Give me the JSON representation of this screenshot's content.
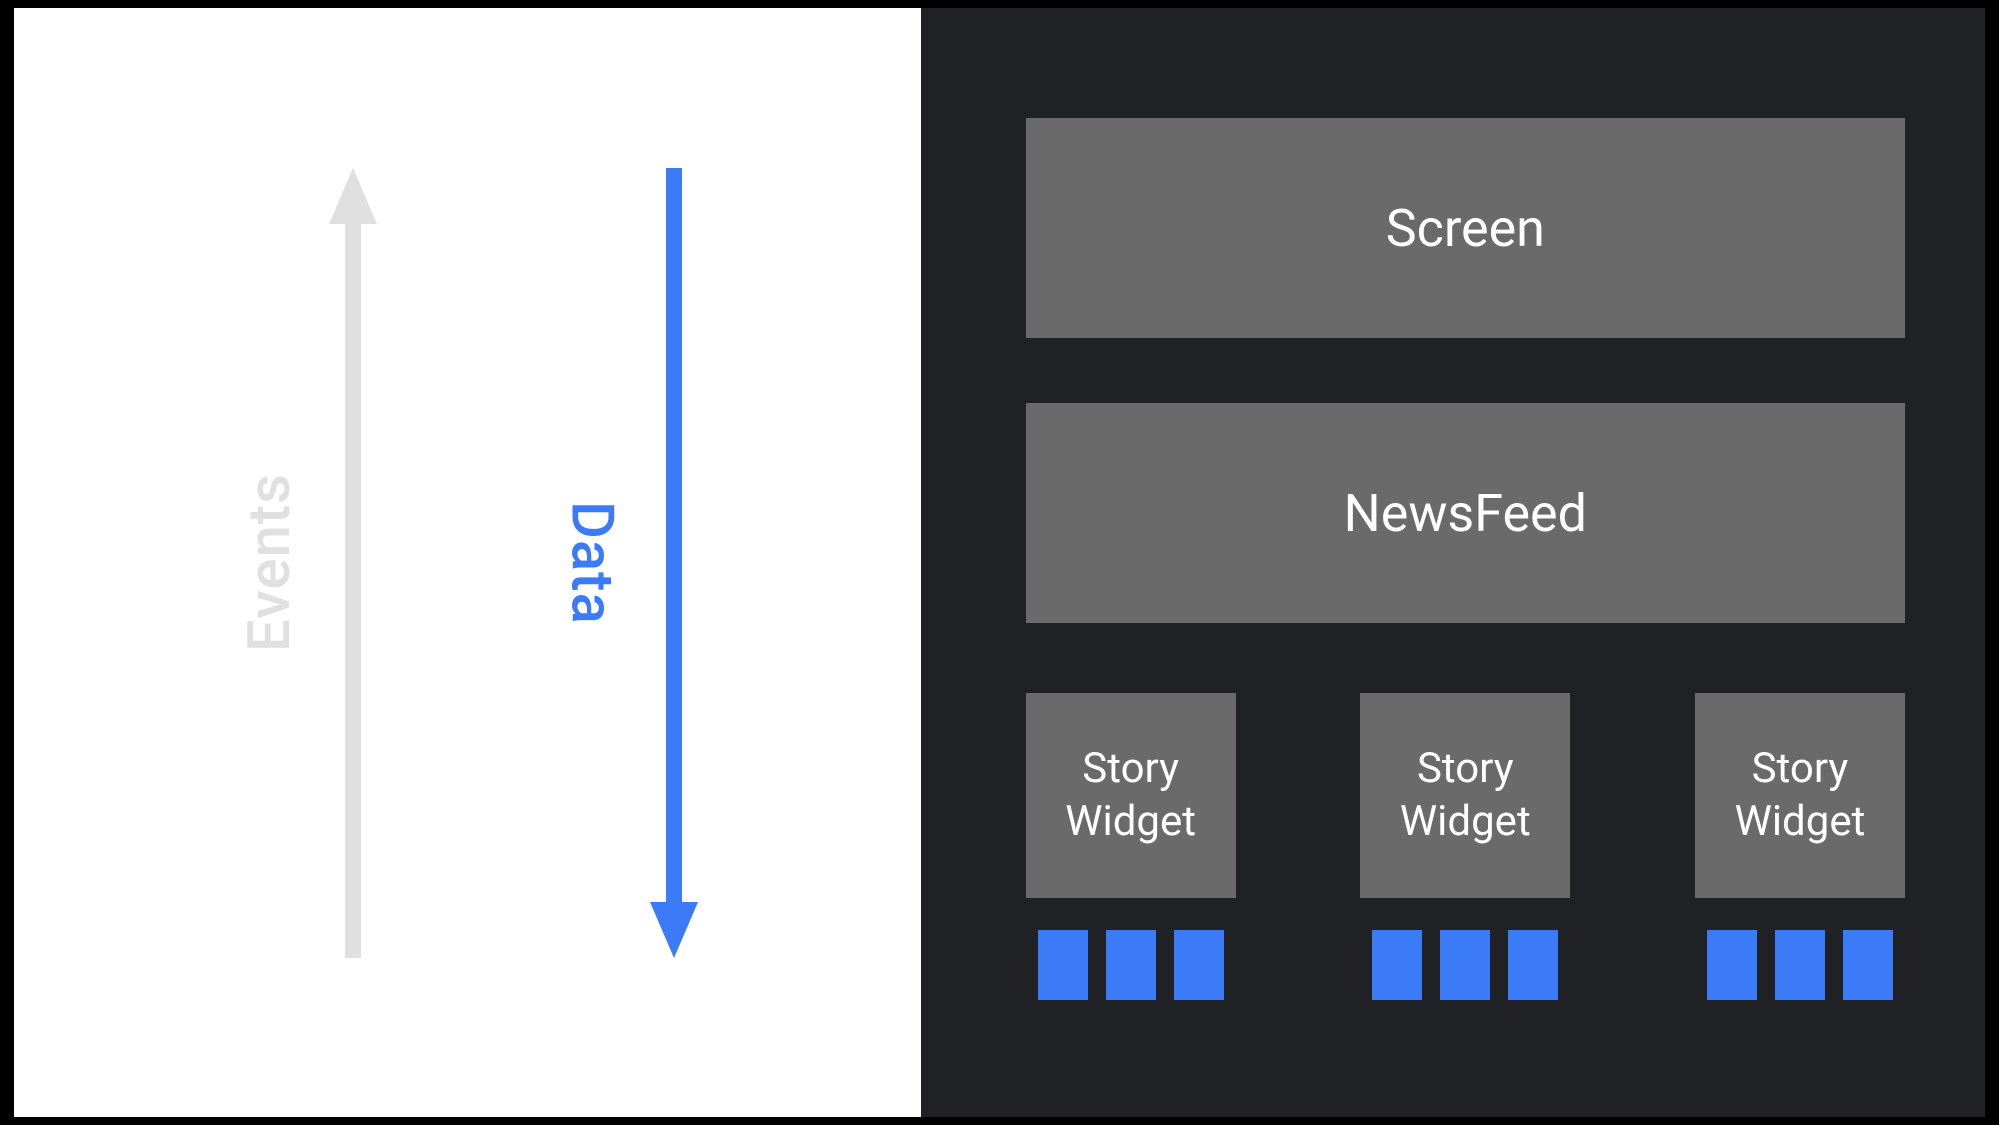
{
  "left": {
    "events_label": "Events",
    "data_label": "Data",
    "colors": {
      "events_arrow": "#e0e0e0",
      "data_arrow": "#3b7bf7"
    }
  },
  "right": {
    "screen_label": "Screen",
    "newsfeed_label": "NewsFeed",
    "story_widgets": [
      {
        "label": "Story\nWidget",
        "chips": 3
      },
      {
        "label": "Story\nWidget",
        "chips": 3
      },
      {
        "label": "Story\nWidget",
        "chips": 3
      }
    ]
  }
}
